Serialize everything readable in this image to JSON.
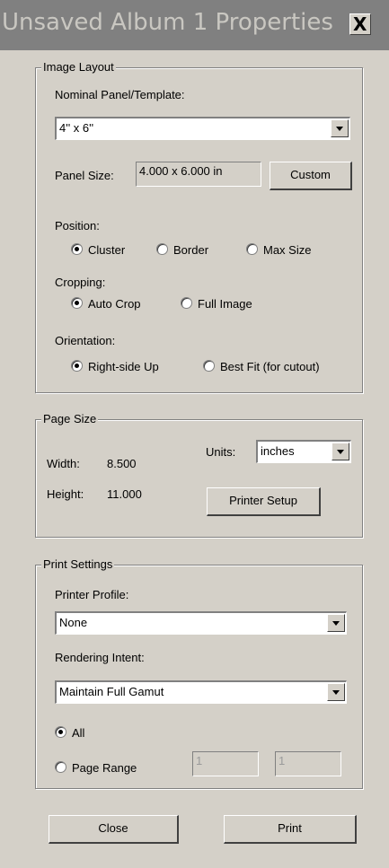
{
  "window": {
    "title": "Unsaved Album 1 Properties",
    "close_glyph": "X"
  },
  "image_layout": {
    "legend": "Image Layout",
    "nominal_label": "Nominal Panel/Template:",
    "nominal_value": "4'' x 6''",
    "panel_size_label": "Panel Size:",
    "panel_size_value": "4.000 x 6.000 in",
    "custom_button": "Custom",
    "position_label": "Position:",
    "position_options": [
      "Cluster",
      "Border",
      "Max Size"
    ],
    "position_selected": "Cluster",
    "cropping_label": "Cropping:",
    "cropping_options": [
      "Auto Crop",
      "Full Image"
    ],
    "cropping_selected": "Auto Crop",
    "orientation_label": "Orientation:",
    "orientation_options": [
      "Right-side Up",
      "Best Fit (for cutout)"
    ],
    "orientation_selected": "Right-side Up"
  },
  "page_size": {
    "legend": "Page Size",
    "width_label": "Width:",
    "width_value": "8.500",
    "height_label": "Height:",
    "height_value": "11.000",
    "units_label": "Units:",
    "units_value": "inches",
    "printer_setup_button": "Printer Setup"
  },
  "print_settings": {
    "legend": "Print Settings",
    "profile_label": "Printer Profile:",
    "profile_value": "None",
    "intent_label": "Rendering Intent:",
    "intent_value": "Maintain Full Gamut",
    "range_options": [
      "All",
      "Page Range"
    ],
    "range_selected": "All",
    "range_from": "1",
    "range_to": "1"
  },
  "footer": {
    "close_button": "Close",
    "print_button": "Print"
  }
}
